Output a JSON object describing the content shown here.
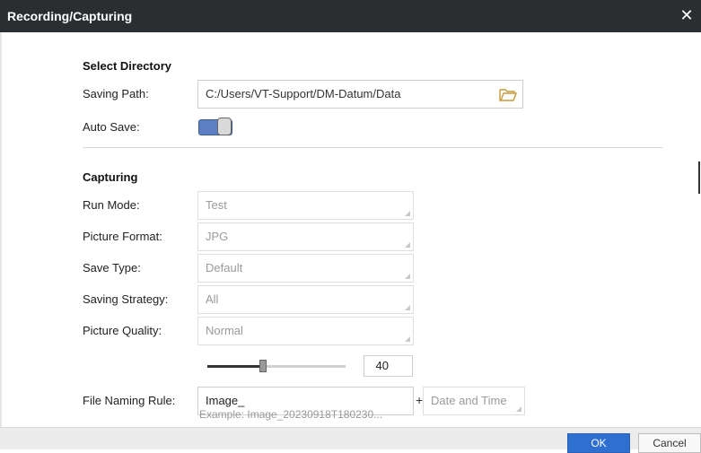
{
  "window": {
    "title": "Recording/Capturing",
    "close_icon": "close-icon"
  },
  "select_directory": {
    "heading": "Select Directory",
    "saving_path_label": "Saving Path:",
    "saving_path_value": "C:/Users/VT-Support/DM-Datum/Data",
    "folder_icon": "folder-open-icon",
    "auto_save_label": "Auto Save:",
    "auto_save_on": true
  },
  "capturing": {
    "heading": "Capturing",
    "run_mode_label": "Run Mode:",
    "run_mode_value": "Test",
    "picture_format_label": "Picture Format:",
    "picture_format_value": "JPG",
    "save_type_label": "Save Type:",
    "save_type_value": "Default",
    "saving_strategy_label": "Saving Strategy:",
    "saving_strategy_value": "All",
    "picture_quality_label": "Picture Quality:",
    "picture_quality_value": "Normal",
    "quality_slider_value": 40,
    "quality_slider_fraction": 0.4,
    "quality_number": "40",
    "file_naming_label": "File Naming Rule:",
    "file_naming_prefix": "Image_",
    "file_naming_plus": "+",
    "file_naming_suffix": "Date and Time",
    "example_partial": "Example: Image_20230918T180230..."
  },
  "footer": {
    "ok_label": "OK",
    "cancel_label": "Cancel"
  },
  "colors": {
    "titlebar": "#2b2e31",
    "toggle_on": "#5b7fc2",
    "ok_button": "#2f6fd0"
  }
}
